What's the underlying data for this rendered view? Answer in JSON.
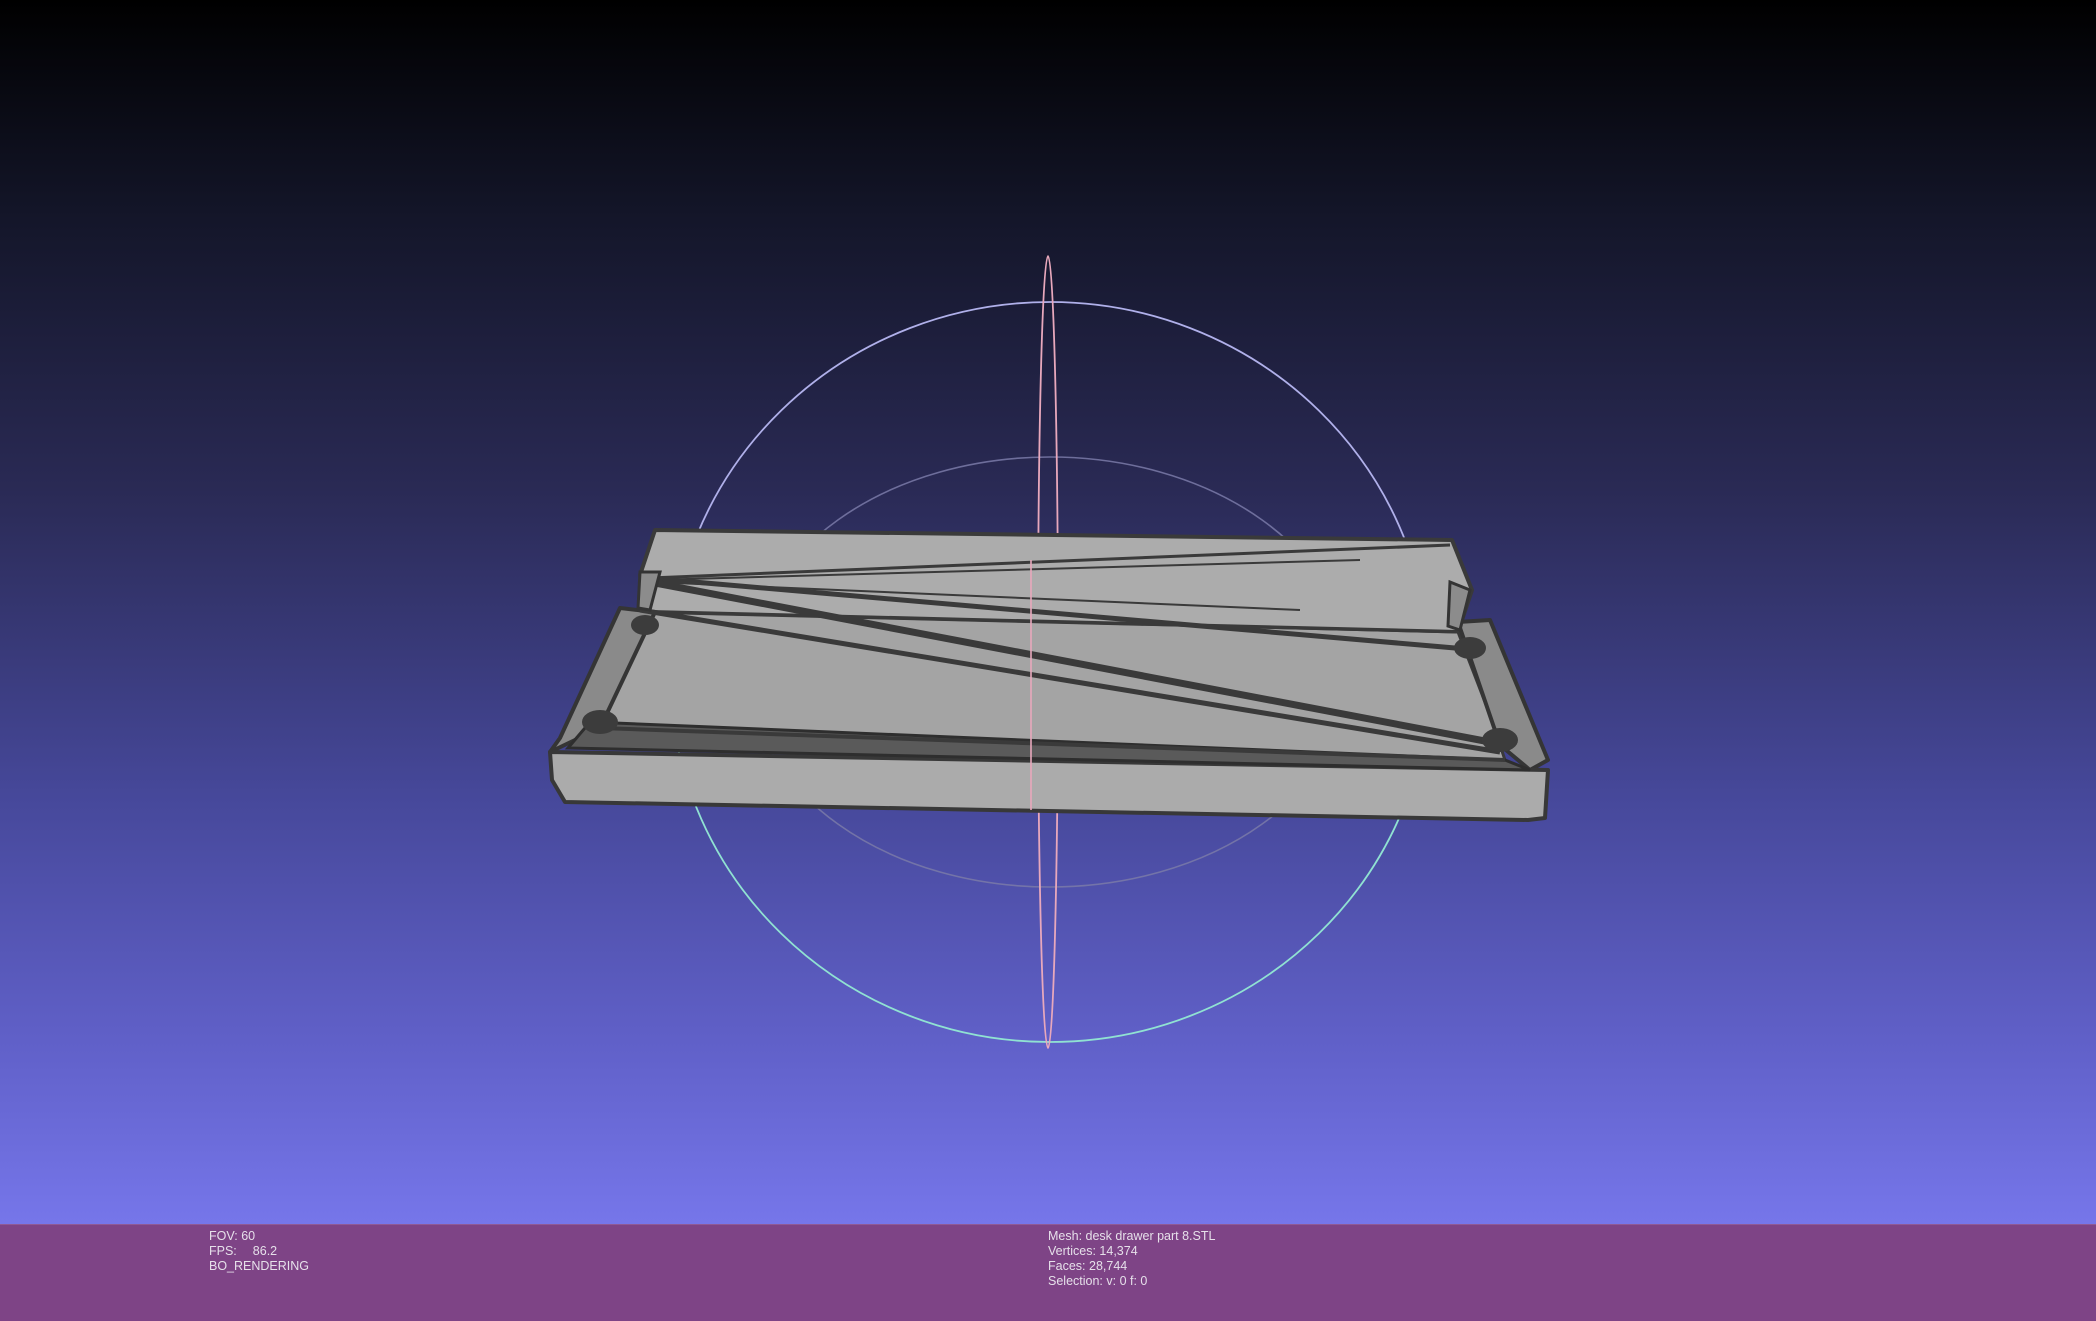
{
  "status": {
    "fov_label": "FOV:",
    "fov_value": "60",
    "fps_label": "FPS:",
    "fps_value": "86.2",
    "render_mode": "BO_RENDERING",
    "mesh_label": "Mesh:",
    "mesh_name": "desk drawer part 8.STL",
    "vertices_label": "Vertices:",
    "vertices_value": "14,374",
    "faces_label": "Faces:",
    "faces_value": "28,744",
    "selection_label": "Selection:",
    "selection_value": "v: 0 f: 0"
  },
  "colors": {
    "background_top": "#000000",
    "background_bottom": "#7676ea",
    "status_bar": "#7e4486",
    "mesh_fill": "#a8a8a8",
    "mesh_edge": "#3c3c3c",
    "trackball_vertical": "#e8a8b8",
    "trackball_top": "#b0b0e8",
    "trackball_bottom": "#90e0d0",
    "trackball_horizontal": "#7a7aa0"
  }
}
